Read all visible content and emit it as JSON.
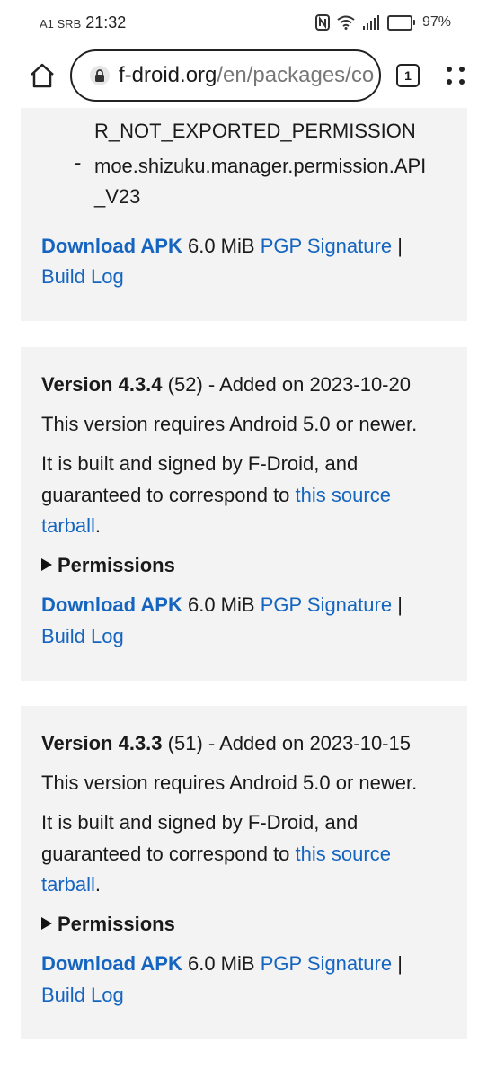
{
  "status_bar": {
    "carrier": "A1 SRB",
    "time": "21:32",
    "battery_percent": "97%",
    "battery_level": 0.97,
    "icons": [
      "nfc-icon",
      "wifi-icon",
      "signal-icon",
      "battery-icon"
    ]
  },
  "browser": {
    "url_host": "f-droid.org",
    "url_path": "/en/packages/co",
    "tab_count": "1",
    "icons": [
      "home-icon",
      "lock-icon",
      "tabs-icon",
      "menu-icon"
    ]
  },
  "top_card": {
    "perm_line_1": "R_NOT_EXPORTED_PERMISSION",
    "perm_line_2a": "moe.shizuku.manager.permission.API",
    "perm_line_2b": "_V23",
    "download_apk": "Download APK",
    "size": "6.0 MiB",
    "pgp": "PGP Signature",
    "separator": "|",
    "build_log": "Build Log"
  },
  "versions": [
    {
      "version_label": "Version 4.3.4",
      "code": "(52)",
      "added": "- Added on 2023-10-20",
      "requires": "This version requires Android 5.0 or newer.",
      "built_line_1": "It is built and signed by F-Droid, and",
      "built_line_2": "guaranteed to correspond to",
      "source_link_1": "this source",
      "source_link_2": "tarball",
      "period": ".",
      "permissions": "Permissions",
      "download_apk": "Download APK",
      "size": "6.0 MiB",
      "pgp": "PGP Signature",
      "separator": "|",
      "build_log": "Build Log"
    },
    {
      "version_label": "Version 4.3.3",
      "code": "(51)",
      "added": "- Added on 2023-10-15",
      "requires": "This version requires Android 5.0 or newer.",
      "built_line_1": "It is built and signed by F-Droid, and",
      "built_line_2": "guaranteed to correspond to",
      "source_link_1": "this source",
      "source_link_2": "tarball",
      "period": ".",
      "permissions": "Permissions",
      "download_apk": "Download APK",
      "size": "6.0 MiB",
      "pgp": "PGP Signature",
      "separator": "|",
      "build_log": "Build Log"
    }
  ],
  "colors": {
    "link": "#1565c0",
    "card_bg": "#f3f3f3"
  }
}
